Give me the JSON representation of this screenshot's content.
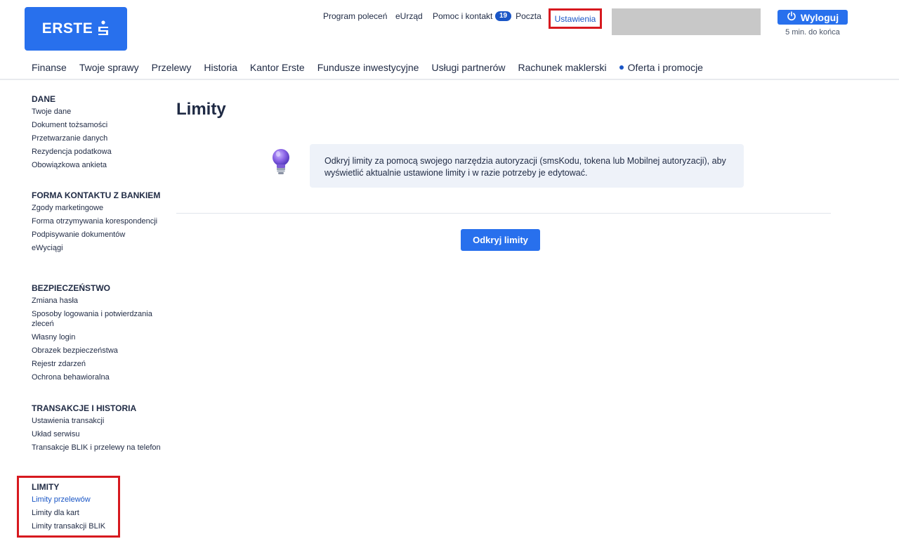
{
  "header": {
    "logo_text": "ERSTE",
    "top_links": {
      "program": "Program poleceń",
      "eurzad": "eUrząd",
      "pomoc": "Pomoc i kontakt",
      "poczta_badge": "19",
      "poczta": "Poczta",
      "ustawienia": "Ustawienia"
    },
    "logout_label": "Wyloguj",
    "session_text": "5 min. do końca"
  },
  "main_nav": {
    "items": [
      "Finanse",
      "Twoje sprawy",
      "Przelewy",
      "Historia",
      "Kantor Erste",
      "Fundusze inwestycyjne",
      "Usługi partnerów",
      "Rachunek maklerski",
      "Oferta i promocje"
    ]
  },
  "sidebar": {
    "dane": {
      "title": "DANE",
      "items": [
        "Twoje dane",
        "Dokument tożsamości",
        "Przetwarzanie danych",
        "Rezydencja podatkowa",
        "Obowiązkowa ankieta"
      ]
    },
    "forma": {
      "title": "FORMA KONTAKTU Z BANKIEM",
      "items": [
        "Zgody marketingowe",
        "Forma otrzymywania korespondencji",
        "Podpisywanie dokumentów",
        "eWyciągi"
      ]
    },
    "bezpieczenstwo": {
      "title": "BEZPIECZEŃSTWO",
      "items": [
        "Zmiana hasła",
        "Sposoby logowania i potwierdzania zleceń",
        "Własny login",
        "Obrazek bezpieczeństwa",
        "Rejestr zdarzeń",
        "Ochrona behawioralna"
      ]
    },
    "transakcje": {
      "title": "TRANSAKCJE I HISTORIA",
      "items": [
        "Ustawienia transakcji",
        "Układ serwisu",
        "Transakcje BLIK i przelewy na telefon"
      ]
    },
    "limity": {
      "title": "LIMITY",
      "items": [
        "Limity przelewów",
        "Limity dla kart",
        "Limity transakcji BLIK"
      ]
    }
  },
  "main": {
    "title": "Limity",
    "info_text": "Odkryj limity za pomocą swojego narzędzia autoryzacji (smsKodu, tokena lub Mobilnej autoryzacji), aby wyświetlić aktualnie ustawione limity i w razie potrzeby je edytować.",
    "open_button": "Odkryj limity"
  },
  "colors": {
    "brand_blue": "#2870ed",
    "link_blue": "#1a56c6",
    "highlight_red": "#d7191f"
  }
}
